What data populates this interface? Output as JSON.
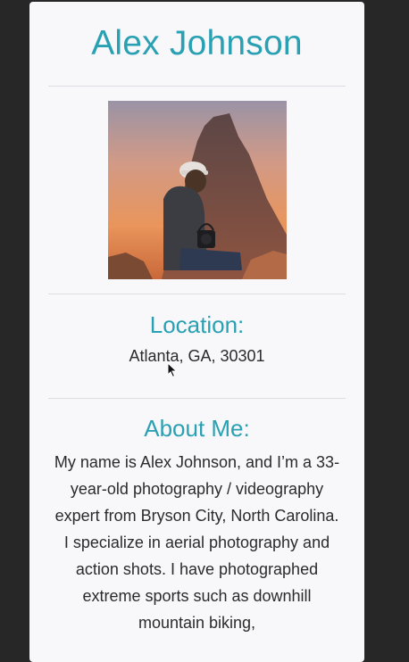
{
  "profile": {
    "name": "Alex Johnson",
    "location_title": "Location:",
    "location_value": "Atlanta, GA, 30301",
    "about_title": "About Me:",
    "about_text": "My name is Alex Johnson, and I’m a 33-year-old photography / videography expert from Bryson City, North Carolina. I specialize in aerial photography and action shots. I have photographed extreme sports such as downhill mountain biking,"
  },
  "colors": {
    "background": "#272727",
    "card": "#f8f8fb",
    "accent": "#2aa0b3",
    "text": "#2b2b2b"
  },
  "icons": {
    "cursor": "mouse-pointer-icon"
  }
}
